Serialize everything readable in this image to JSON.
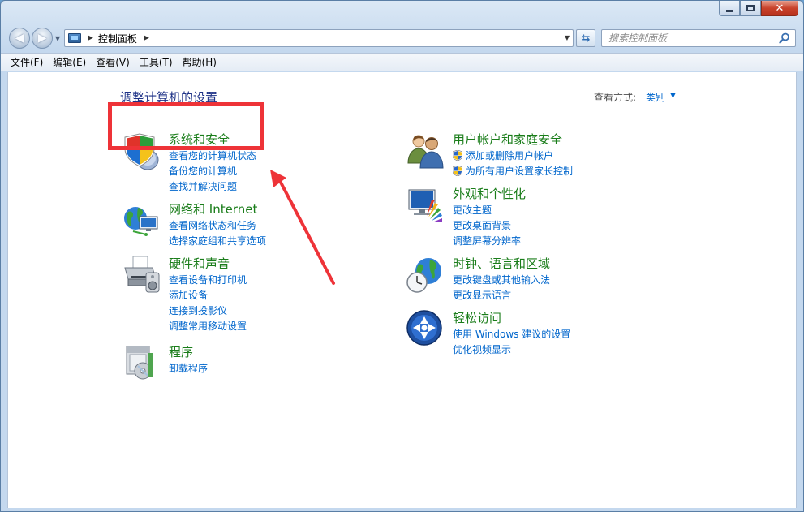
{
  "address_bar": {
    "path_label": "控制面板"
  },
  "search": {
    "placeholder": "搜索控制面板"
  },
  "menu": [
    "文件(F)",
    "编辑(E)",
    "查看(V)",
    "工具(T)",
    "帮助(H)"
  ],
  "content": {
    "title": "调整计算机的设置",
    "view_by_label": "查看方式:",
    "view_by_value": "类别"
  },
  "categories": {
    "system_security": {
      "title": "系统和安全",
      "links": [
        "查看您的计算机状态",
        "备份您的计算机",
        "查找并解决问题"
      ]
    },
    "network": {
      "title": "网络和 Internet",
      "links": [
        "查看网络状态和任务",
        "选择家庭组和共享选项"
      ]
    },
    "hardware": {
      "title": "硬件和声音",
      "links": [
        "查看设备和打印机",
        "添加设备",
        "连接到投影仪",
        "调整常用移动设置"
      ]
    },
    "programs": {
      "title": "程序",
      "links": [
        "卸载程序"
      ]
    },
    "user_accounts": {
      "title": "用户帐户和家庭安全",
      "links": [
        "添加或删除用户帐户",
        "为所有用户设置家长控制"
      ]
    },
    "appearance": {
      "title": "外观和个性化",
      "links": [
        "更改主题",
        "更改桌面背景",
        "调整屏幕分辨率"
      ]
    },
    "clock_region": {
      "title": "时钟、语言和区域",
      "links": [
        "更改键盘或其他输入法",
        "更改显示语言"
      ]
    },
    "ease_of_access": {
      "title": "轻松访问",
      "links": [
        "使用 Windows 建议的设置",
        "优化视频显示"
      ]
    }
  },
  "colors": {
    "category_title": "#1a7d1a",
    "link": "#0066cc",
    "annotation": "#ee3338"
  }
}
